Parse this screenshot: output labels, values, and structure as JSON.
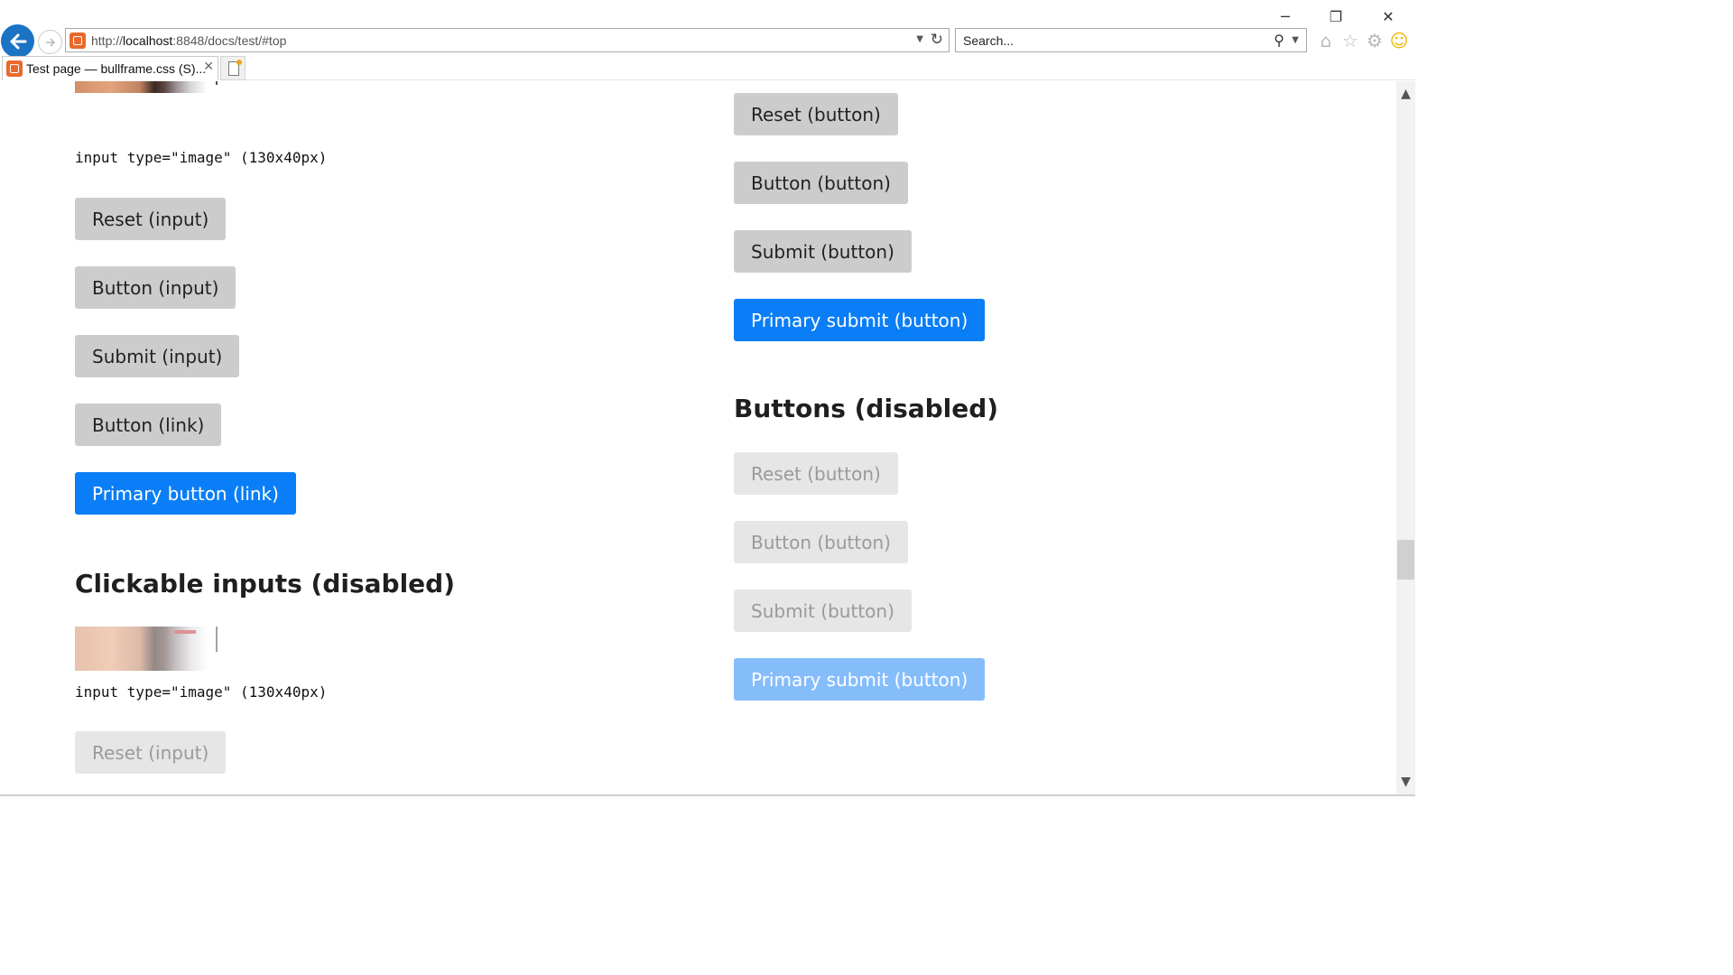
{
  "browser": {
    "url_prefix": "http://",
    "url_host": "localhost",
    "url_rest": ":8848/docs/test/#top",
    "search_placeholder": "Search...",
    "tab_title": "Test page — bullframe.css (S)...",
    "icons": {
      "back": "back-arrow-icon",
      "forward": "forward-arrow-icon",
      "refresh": "refresh-icon",
      "search": "search-icon",
      "home": "home-icon",
      "favorites": "star-icon",
      "settings": "gear-icon",
      "feedback": "smiley-icon"
    },
    "window_controls": {
      "minimize": "─",
      "restore": "❐",
      "close": "✕"
    }
  },
  "left": {
    "image_input_label": "input type=\"image\" (130x40px)",
    "buttons": [
      {
        "label": "Reset (input)",
        "primary": false
      },
      {
        "label": "Button (input)",
        "primary": false
      },
      {
        "label": "Submit (input)",
        "primary": false
      },
      {
        "label": "Button (link)",
        "primary": false
      },
      {
        "label": "Primary button (link)",
        "primary": true
      }
    ],
    "disabled_heading": "Clickable inputs (disabled)",
    "disabled_image_input_label": "input type=\"image\" (130x40px)",
    "disabled_buttons": [
      {
        "label": "Reset (input)"
      }
    ]
  },
  "right": {
    "buttons": [
      {
        "label": "Reset (button)",
        "primary": false
      },
      {
        "label": "Button (button)",
        "primary": false
      },
      {
        "label": "Submit (button)",
        "primary": false
      },
      {
        "label": "Primary submit (button)",
        "primary": true
      }
    ],
    "disabled_heading": "Buttons (disabled)",
    "disabled_buttons": [
      {
        "label": "Reset (button)",
        "primary": false
      },
      {
        "label": "Button (button)",
        "primary": false
      },
      {
        "label": "Submit (button)",
        "primary": false
      },
      {
        "label": "Primary submit (button)",
        "primary": true
      }
    ]
  },
  "colors": {
    "primary": "#0a7ef7",
    "primary_disabled": "#85bdfb",
    "button_bg": "#cccccc",
    "button_disabled_bg": "#e6e6e6"
  }
}
